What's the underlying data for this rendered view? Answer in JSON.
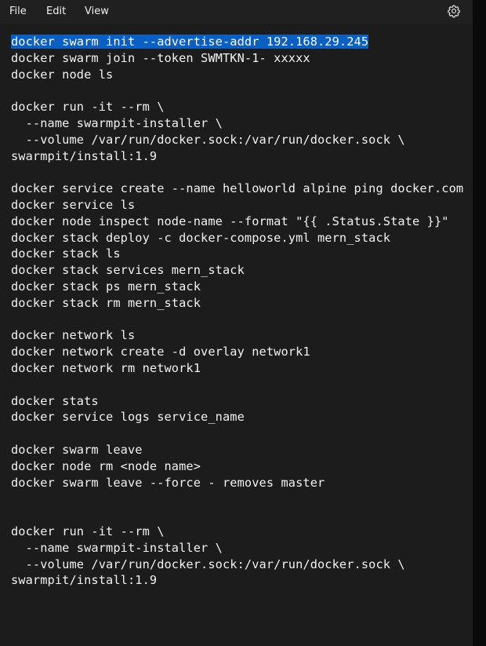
{
  "menu": {
    "file": "File",
    "edit": "Edit",
    "view": "View",
    "settings_icon": "gear-icon"
  },
  "colors": {
    "background": "#1c1c1c",
    "text": "#f2f2f2",
    "selection": "#0a5fc2"
  },
  "editor": {
    "selected_line": 0,
    "lines": [
      "docker swarm init --advertise-addr 192.168.29.245",
      "docker swarm join --token SWMTKN-1- xxxxx",
      "docker node ls",
      "",
      "docker run -it --rm \\",
      "  --name swarmpit-installer \\",
      "  --volume /var/run/docker.sock:/var/run/docker.sock \\",
      "swarmpit/install:1.9",
      "",
      "docker service create --name helloworld alpine ping docker.com",
      "docker service ls",
      "docker node inspect node-name --format \"{{ .Status.State }}\"",
      "docker stack deploy -c docker-compose.yml mern_stack",
      "docker stack ls",
      "docker stack services mern_stack",
      "docker stack ps mern_stack",
      "docker stack rm mern_stack",
      "",
      "docker network ls",
      "docker network create -d overlay network1",
      "docker network rm network1",
      "",
      "docker stats",
      "docker service logs service_name",
      "",
      "docker swarm leave",
      "docker node rm <node name>",
      "docker swarm leave --force - removes master",
      "",
      "",
      "docker run -it --rm \\",
      "  --name swarmpit-installer \\",
      "  --volume /var/run/docker.sock:/var/run/docker.sock \\",
      "swarmpit/install:1.9"
    ]
  }
}
